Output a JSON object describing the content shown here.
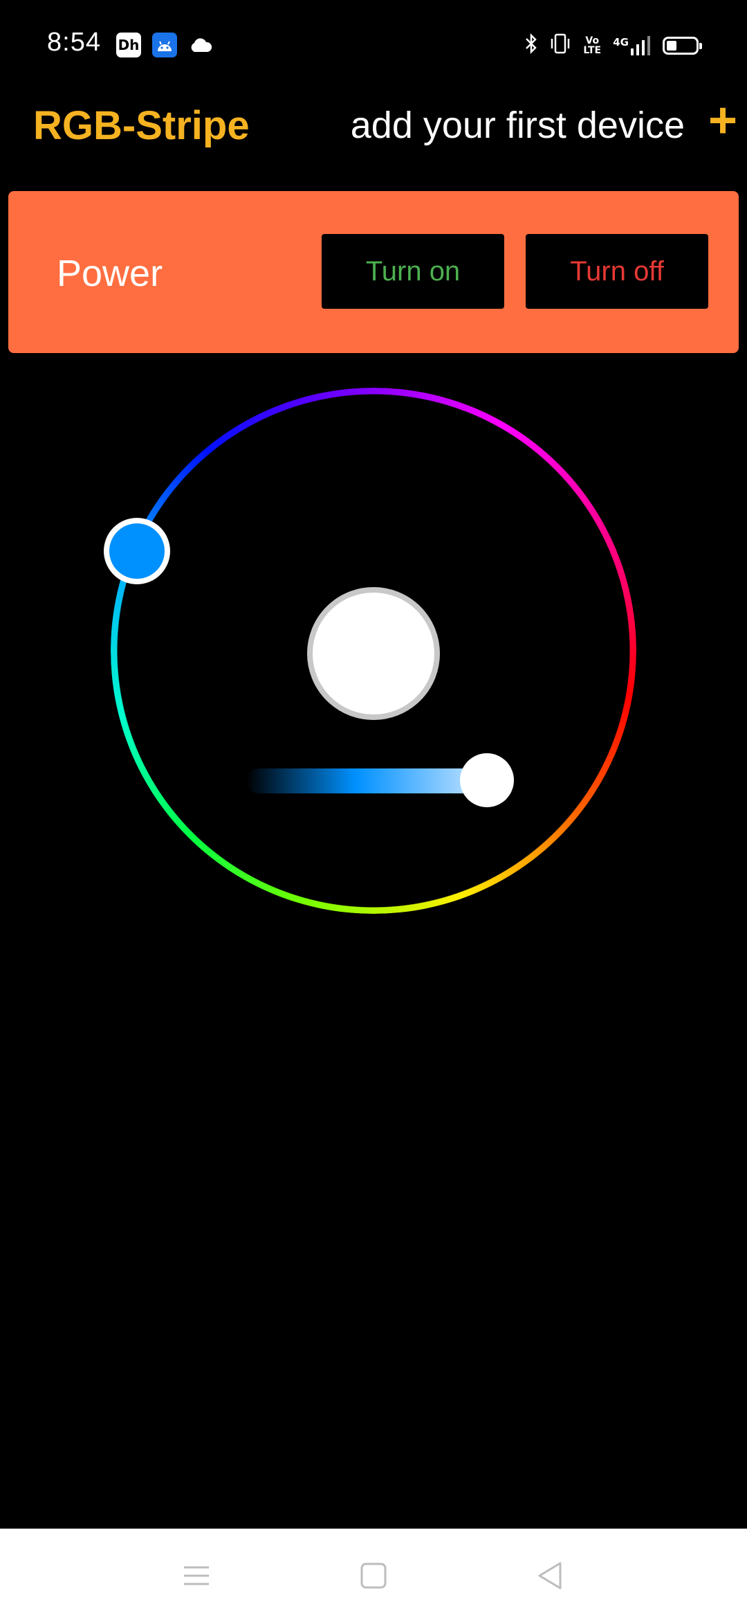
{
  "status_bar": {
    "time": "8:54",
    "app_icons": [
      "disney-plus-hotstar-icon",
      "android-icon",
      "cloud-icon"
    ],
    "disney_glyph": "Dh",
    "right_icons": [
      "bluetooth-icon",
      "vibrate-icon",
      "volte-icon",
      "signal-4g-icon",
      "battery-icon"
    ],
    "volte_text": "Vo LTE",
    "network_text": "4G"
  },
  "header": {
    "title": "RGB-Stripe",
    "add_device_label": "add your first device",
    "add_button": "+"
  },
  "power": {
    "label": "Power",
    "turn_on_label": "Turn on",
    "turn_off_label": "Turn off"
  },
  "color_picker": {
    "selected_color": "#0091ff",
    "center_color": "#ffffff",
    "brightness_percent": 100
  },
  "colors": {
    "accent": "#f5b221",
    "power_card": "#ff6e40",
    "turn_on_text": "#4caf50",
    "turn_off_text": "#e53935",
    "background": "#000000"
  },
  "nav_bar": {
    "icons": [
      "menu-icon",
      "home-icon",
      "back-icon"
    ]
  }
}
